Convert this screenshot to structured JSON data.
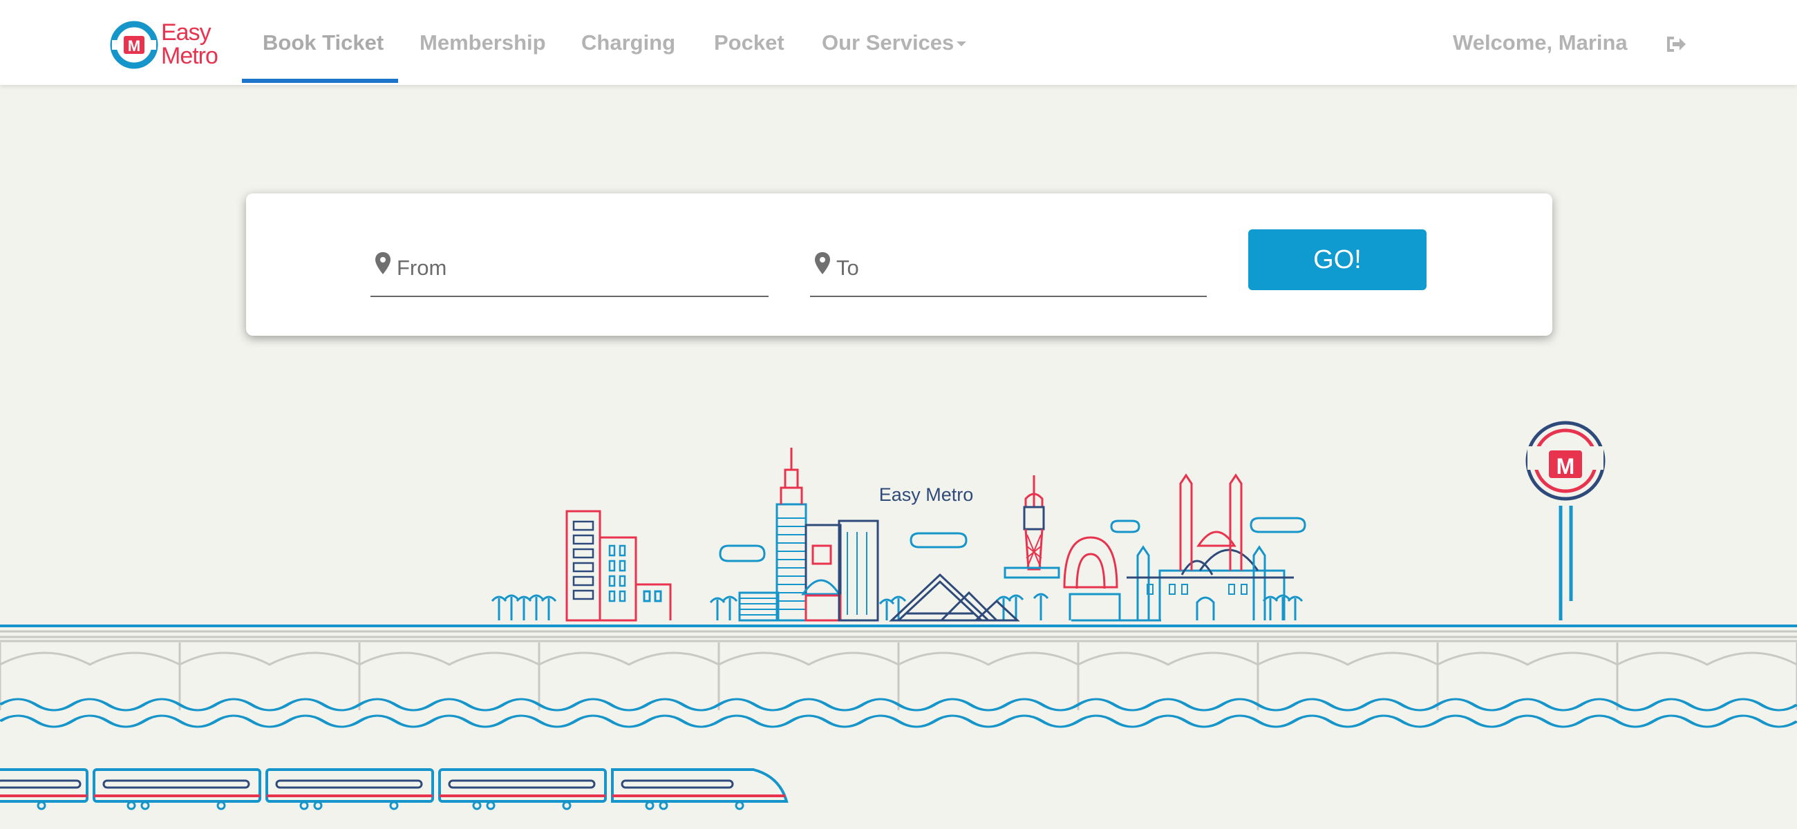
{
  "app": {
    "logo_line1": "Easy",
    "logo_line2": "Metro"
  },
  "nav": {
    "items": [
      {
        "label": "Book Ticket",
        "active": true
      },
      {
        "label": "Membership"
      },
      {
        "label": "Charging"
      },
      {
        "label": "Pocket"
      },
      {
        "label": "Our Services"
      }
    ],
    "welcome": "Welcome, Marina",
    "logout_icon": "sign-out-icon"
  },
  "search": {
    "from_placeholder": "From",
    "to_placeholder": "To",
    "go_label": "GO!",
    "pin_icon": "map-marker-icon"
  },
  "illustration": {
    "caption": "Easy Metro"
  },
  "colors": {
    "accent": "#0f9bd0",
    "brand_red": "#e8334f",
    "brand_navy": "#2e4a7a",
    "nav_active": "#1f73c8",
    "background": "#f3f3ee"
  }
}
